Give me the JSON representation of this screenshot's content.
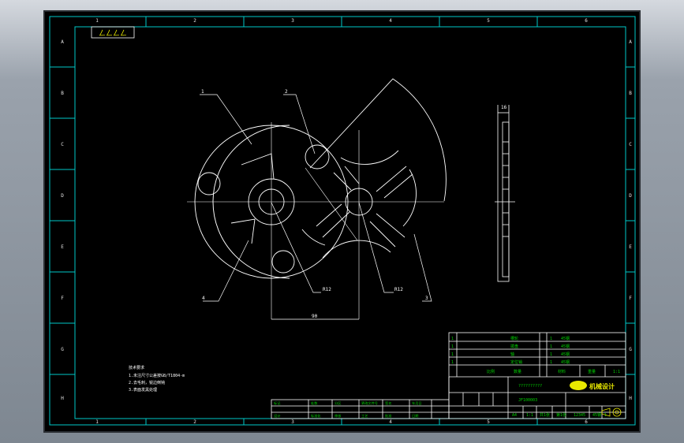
{
  "colors": {
    "frame": "#00c8c8",
    "line": "#ffffff",
    "text": "#f0f000",
    "green": "#00d200",
    "block": "#e8e800"
  },
  "zones": {
    "top": [
      "1",
      "2",
      "3",
      "4",
      "5",
      "6"
    ],
    "side": [
      "A",
      "B",
      "C",
      "D",
      "E",
      "F",
      "G",
      "H"
    ]
  },
  "corner_mark": "ㄥㄥㄥㄥ",
  "parts": {
    "p1": {
      "id": "1"
    },
    "p2": {
      "id": "2"
    },
    "p3": {
      "id": "3"
    },
    "p4": {
      "id": "4"
    },
    "r1": {
      "label": "R12"
    },
    "r2": {
      "label": "R12"
    },
    "dim": {
      "value": "90"
    },
    "side_dim": {
      "value": "16"
    }
  },
  "notes": {
    "title": "技术要求",
    "line1": "1.未注尺寸公差按GB/T1804-m",
    "line2": "2.去毛刺，锐边倒钝",
    "line3": "3.表面发黑处理"
  },
  "title_block": {
    "rows": [
      "1",
      "1",
      "1",
      "1"
    ],
    "r1": "槽轮",
    "r2": "拨盘",
    "r3": "轴",
    "r4": "定位销",
    "m1": "45钢",
    "m2": "45钢",
    "m3": "45钢",
    "m4": "45钢",
    "name": "??????????",
    "drawing_no": "JF100003",
    "logo_text": "机械设计",
    "scale": "1:1",
    "material": "45钢",
    "qty": "1",
    "c1": "比例",
    "c2": "数量",
    "c3": "材料",
    "c4": "重量",
    "ab1": "A4",
    "ab2": "1:1",
    "ab3": "共1张",
    "ab4": "第1张",
    "ab5": "12345"
  },
  "grid_header": [
    "标记",
    "处数",
    "分区",
    "更改文件号",
    "签名",
    "年月日"
  ],
  "grid_row2": [
    "设计",
    "标准化",
    "审核",
    "工艺",
    "批准",
    "日期"
  ]
}
